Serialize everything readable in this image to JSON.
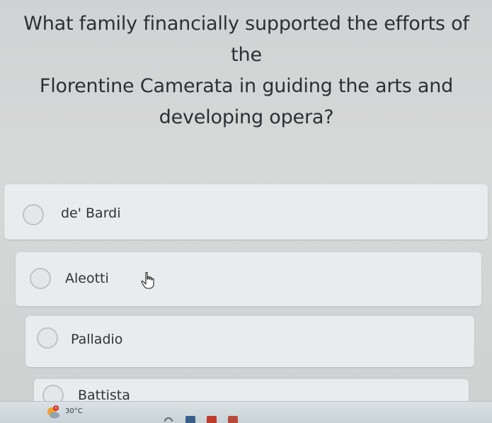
{
  "question": {
    "line1": "What family financially supported the efforts of the",
    "line2": "Florentine Camerata in guiding the arts and",
    "line3": "developing opera?"
  },
  "options": [
    {
      "label": "de' Bardi"
    },
    {
      "label": "Aleotti"
    },
    {
      "label": "Palladio"
    },
    {
      "label": "Battista"
    }
  ],
  "taskbar": {
    "temperature": "30°C",
    "weather_icon": "sun-cloud-icon",
    "pinned_icons": [
      "edge-icon",
      "store-icon",
      "office-icon",
      "explorer-icon"
    ]
  },
  "colors": {
    "page_background": "#d3d6d6",
    "option_background": "#e9ecec",
    "radio_border": "#bfc3c5",
    "text": "#2c2f34",
    "weather_accent": "#f0a030",
    "notification_badge": "#d9342b"
  }
}
